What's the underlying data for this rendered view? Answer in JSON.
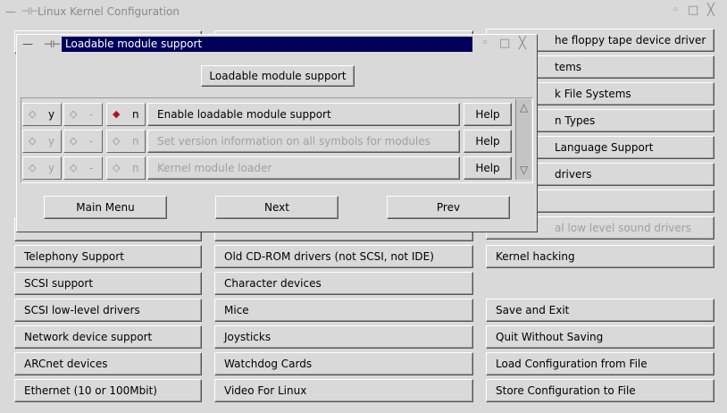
{
  "main": {
    "title": "Linux Kernel Configuration",
    "wbtns": [
      "◦",
      "□",
      "╳"
    ],
    "col1": [
      "Telephony Support",
      "SCSI support",
      "SCSI low-level drivers",
      "Network device support",
      "ARCnet devices",
      "Ethernet (10 or 100Mbit)"
    ],
    "col2": [
      "Old CD-ROM drivers (not SCSI, not IDE)",
      "Character devices",
      "Mice",
      "Joysticks",
      "Watchdog Cards",
      "Video For Linux"
    ],
    "col3_top": [
      "he floppy tape device driver",
      "tems",
      "k File Systems",
      "n Types",
      "Language Support",
      " drivers",
      "",
      "al low level sound drivers"
    ],
    "col3_bottom": [
      "Kernel hacking",
      "",
      "Save and Exit",
      "Quit Without Saving",
      "Load Configuration from File",
      "Store Configuration to File"
    ]
  },
  "dialog": {
    "title": "Loadable module support",
    "header_button": "Loadable module support",
    "rows": [
      {
        "y": "y",
        "m": "-",
        "n": "n",
        "label": "Enable loadable module support",
        "help": "Help",
        "enabled": true
      },
      {
        "y": "y",
        "m": "-",
        "n": "n",
        "label": "Set version information on all symbols for modules",
        "help": "Help",
        "enabled": false
      },
      {
        "y": "y",
        "m": "-",
        "n": "n",
        "label": "Kernel module loader",
        "help": "Help",
        "enabled": false
      }
    ],
    "nav": {
      "main_menu": "Main Menu",
      "next": "Next",
      "prev": "Prev"
    },
    "selected_color": "#b01030"
  }
}
